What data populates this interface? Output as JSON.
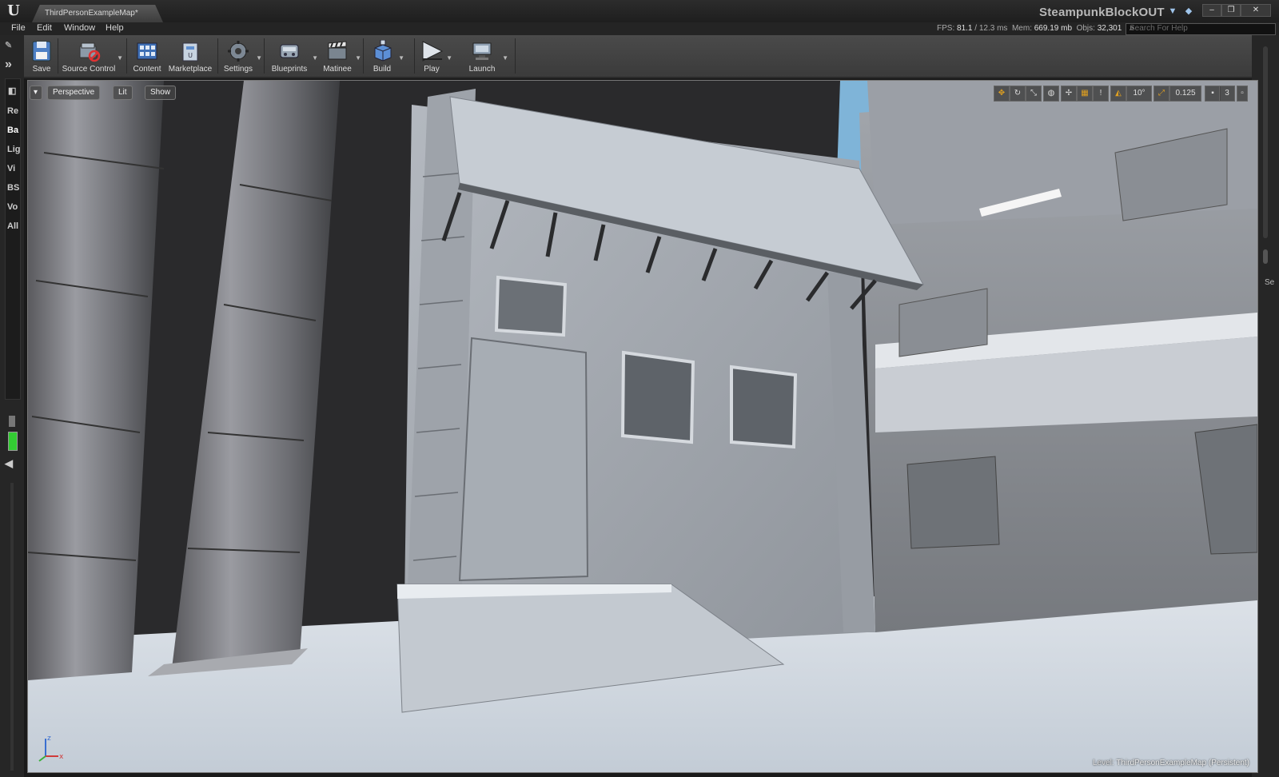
{
  "window": {
    "tab_title": "ThirdPersonExampleMap*",
    "project_title": "SteampunkBlockOUT",
    "controls": [
      "–",
      "❐",
      "✕"
    ]
  },
  "menu": [
    "File",
    "Edit",
    "Window",
    "Help"
  ],
  "stats": {
    "fps_label": "FPS:",
    "fps": "81.1",
    "ms": "/ 12.3 ms",
    "mem_label": "Mem:",
    "mem": "669.19 mb",
    "objs_label": "Objs:",
    "objs": "32,301"
  },
  "search": {
    "placeholder": "Search For Help"
  },
  "toolbar": [
    {
      "label": "Save",
      "icon": "save-icon"
    },
    {
      "label": "Source Control",
      "icon": "source-control-icon"
    },
    {
      "label": "Content",
      "icon": "content-icon"
    },
    {
      "label": "Marketplace",
      "icon": "marketplace-icon"
    },
    {
      "label": "Settings",
      "icon": "settings-icon"
    },
    {
      "label": "Blueprints",
      "icon": "blueprints-icon"
    },
    {
      "label": "Matinee",
      "icon": "matinee-icon"
    },
    {
      "label": "Build",
      "icon": "build-icon"
    },
    {
      "label": "Play",
      "icon": "play-icon"
    },
    {
      "label": "Launch",
      "icon": "launch-icon"
    }
  ],
  "left_tabs": [
    "Re",
    "Ba",
    "Lig",
    "Vi",
    "BS",
    "Vo",
    "All"
  ],
  "right_tab": "Se",
  "viewport": {
    "mode_buttons": [
      "Perspective",
      "Lit",
      "Show"
    ],
    "snap_angle": "10°",
    "snap_scale": "0.125",
    "camera_speed": "3",
    "level_label": "Level:",
    "level_name": "ThirdPersonExampleMap (Persistent)"
  },
  "colors": {
    "accent": "#e0a020",
    "frame_border": "#c8a032",
    "sky": "#7fb4d8"
  }
}
